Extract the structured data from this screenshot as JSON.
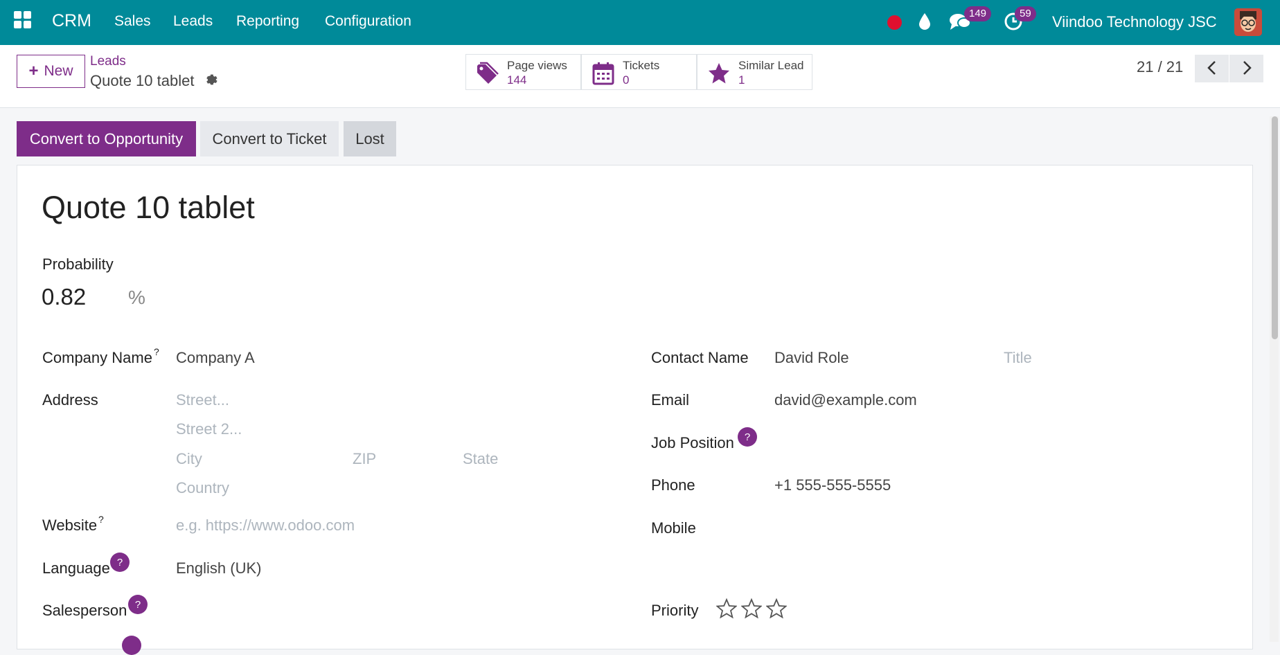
{
  "topbar": {
    "brand": "CRM",
    "menu": [
      "Sales",
      "Leads",
      "Reporting",
      "Configuration"
    ],
    "messages_count": "149",
    "activities_count": "59",
    "company": "Viindoo Technology JSC",
    "accent": "#008a99"
  },
  "control_panel": {
    "new_label": "New",
    "breadcrumb_parent": "Leads",
    "breadcrumb_current": "Quote 10 tablet",
    "smart_buttons": [
      {
        "label": "Page views",
        "value": "144",
        "icon": "tag-icon"
      },
      {
        "label": "Tickets",
        "value": "0",
        "icon": "calendar-icon"
      },
      {
        "label": "Similar Lead",
        "value": "1",
        "icon": "star-icon"
      }
    ],
    "pager": "21 / 21"
  },
  "status_buttons": {
    "convert_opportunity": "Convert to Opportunity",
    "convert_ticket": "Convert to Ticket",
    "lost": "Lost"
  },
  "form": {
    "title": "Quote 10 tablet",
    "probability_label": "Probability",
    "probability_value": "0.82",
    "probability_unit": "%",
    "left": {
      "company_name_label": "Company Name",
      "company_name_value": "Company A",
      "address_label": "Address",
      "street_ph": "Street...",
      "street2_ph": "Street 2...",
      "city_ph": "City",
      "zip_ph": "ZIP",
      "state_ph": "State",
      "country_ph": "Country",
      "website_label": "Website",
      "website_ph": "e.g. https://www.odoo.com",
      "language_label": "Language",
      "language_value": "English (UK)",
      "salesperson_label": "Salesperson"
    },
    "right": {
      "contact_name_label": "Contact Name",
      "contact_name_value": "David Role",
      "title_ph": "Title",
      "email_label": "Email",
      "email_value": "david@example.com",
      "job_position_label": "Job Position",
      "phone_label": "Phone",
      "phone_value": "+1 555-555-5555",
      "mobile_label": "Mobile",
      "priority_label": "Priority",
      "priority_stars": 0
    },
    "help_mark": "?"
  },
  "colors": {
    "primary": "#7e2d89",
    "teal": "#008a99",
    "record": "#e0102f"
  }
}
